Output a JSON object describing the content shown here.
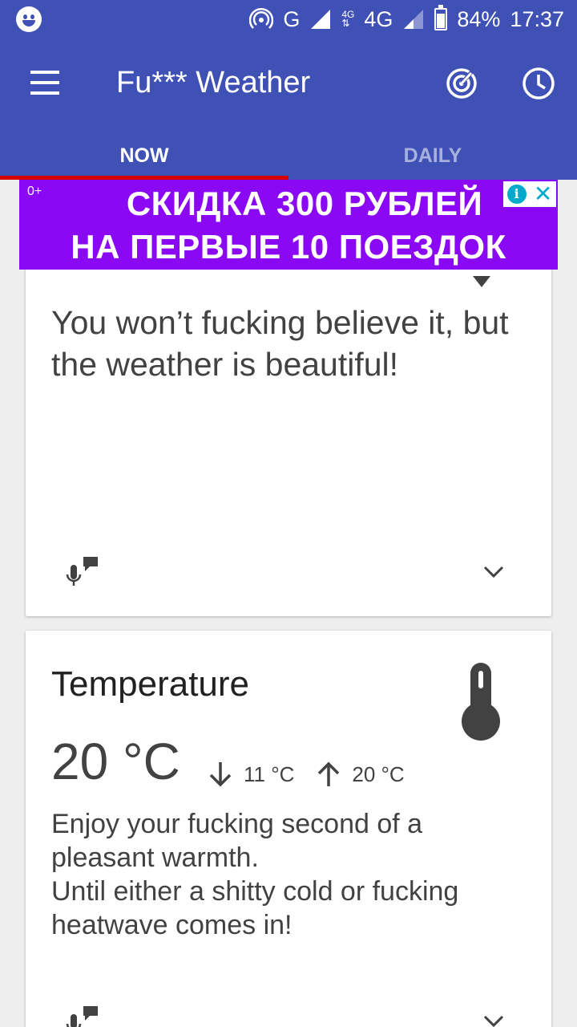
{
  "status_bar": {
    "network_type": "G",
    "network_small_top": "4G",
    "network_main": "4G",
    "battery_percent": "84%",
    "battery_level": 0.84,
    "time": "17:37"
  },
  "app_bar": {
    "title": "Fu*** Weather"
  },
  "tabs": [
    {
      "label": "NOW",
      "active": true
    },
    {
      "label": "DAILY",
      "active": false
    }
  ],
  "ad": {
    "age_rating": "0+",
    "line1": "СКИДКА 300 РУБЛЕЙ",
    "line2": "НА ПЕРВЫЕ 10 ПОЕЗДОК",
    "info_glyph": "i",
    "close_glyph": "✕"
  },
  "summary_card": {
    "text": "You won’t fucking believe it, but the weather is beautiful!"
  },
  "temperature_card": {
    "title": "Temperature",
    "current": "20 °C",
    "min": "11 °C",
    "max": "20 °C",
    "description_line1": "Enjoy your fucking second of a pleasant warmth.",
    "description_line2": "Until either a shitty cold or fucking heatwave comes in!"
  },
  "colors": {
    "primary": "#3f51b5",
    "tab_indicator": "#d50000",
    "ad_background": "#8b08f5",
    "icon_dark": "#424242"
  }
}
